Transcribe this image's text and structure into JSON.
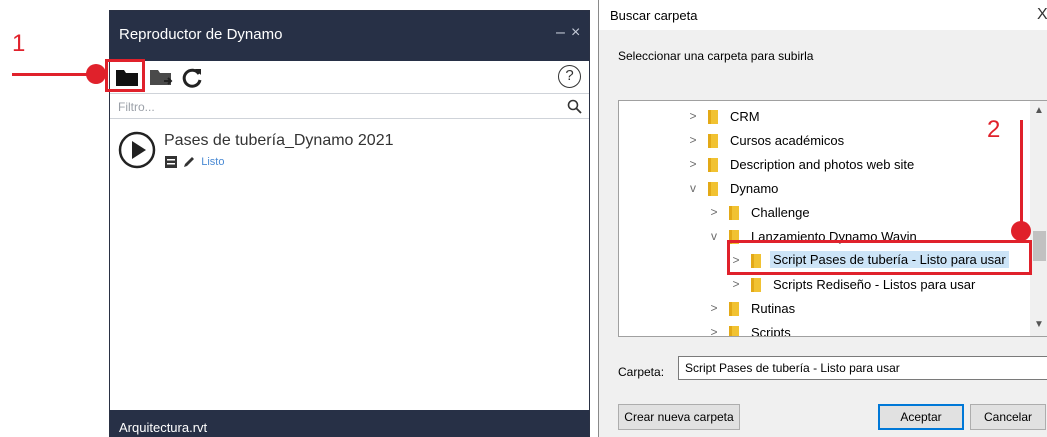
{
  "player": {
    "title": "Reproductor de Dynamo",
    "minimize": "–",
    "close": "×",
    "help": "?",
    "filter_placeholder": "Filtro...",
    "script": {
      "name": "Pases de tubería_Dynamo 2021",
      "status": "Listo"
    },
    "footer": "Arquitectura.rvt"
  },
  "annotations": {
    "step1": "1",
    "step2": "2",
    "color": "#e0212b"
  },
  "dialog": {
    "title": "Buscar carpeta",
    "close": "X",
    "caption": "Seleccionar una carpeta para subirla",
    "tree": [
      {
        "label": "CRM",
        "chevron": ">"
      },
      {
        "label": "Cursos académicos",
        "chevron": ">"
      },
      {
        "label": "Description and photos web site",
        "chevron": ">"
      },
      {
        "label": "Dynamo",
        "chevron": "v"
      },
      {
        "label": "Challenge",
        "chevron": ">"
      },
      {
        "label": "Lanzamiento Dynamo Wavin",
        "chevron": "v"
      },
      {
        "label": "Script Pases de tubería - Listo para usar",
        "chevron": ">"
      },
      {
        "label": "Scripts Rediseño - Listos para usar",
        "chevron": ">"
      },
      {
        "label": "Rutinas",
        "chevron": ">"
      },
      {
        "label": "Scripts",
        "chevron": ">"
      }
    ],
    "folder_label": "Carpeta:",
    "folder_value": "Script Pases de tubería - Listo para usar",
    "new_folder_button": "Crear nueva carpeta",
    "ok_button": "Aceptar",
    "cancel_button": "Cancelar"
  },
  "colors": {
    "panel_header": "#273046",
    "status_link": "#4a8ad4",
    "selection": "#cce4f7",
    "folder": "#f1c232"
  }
}
